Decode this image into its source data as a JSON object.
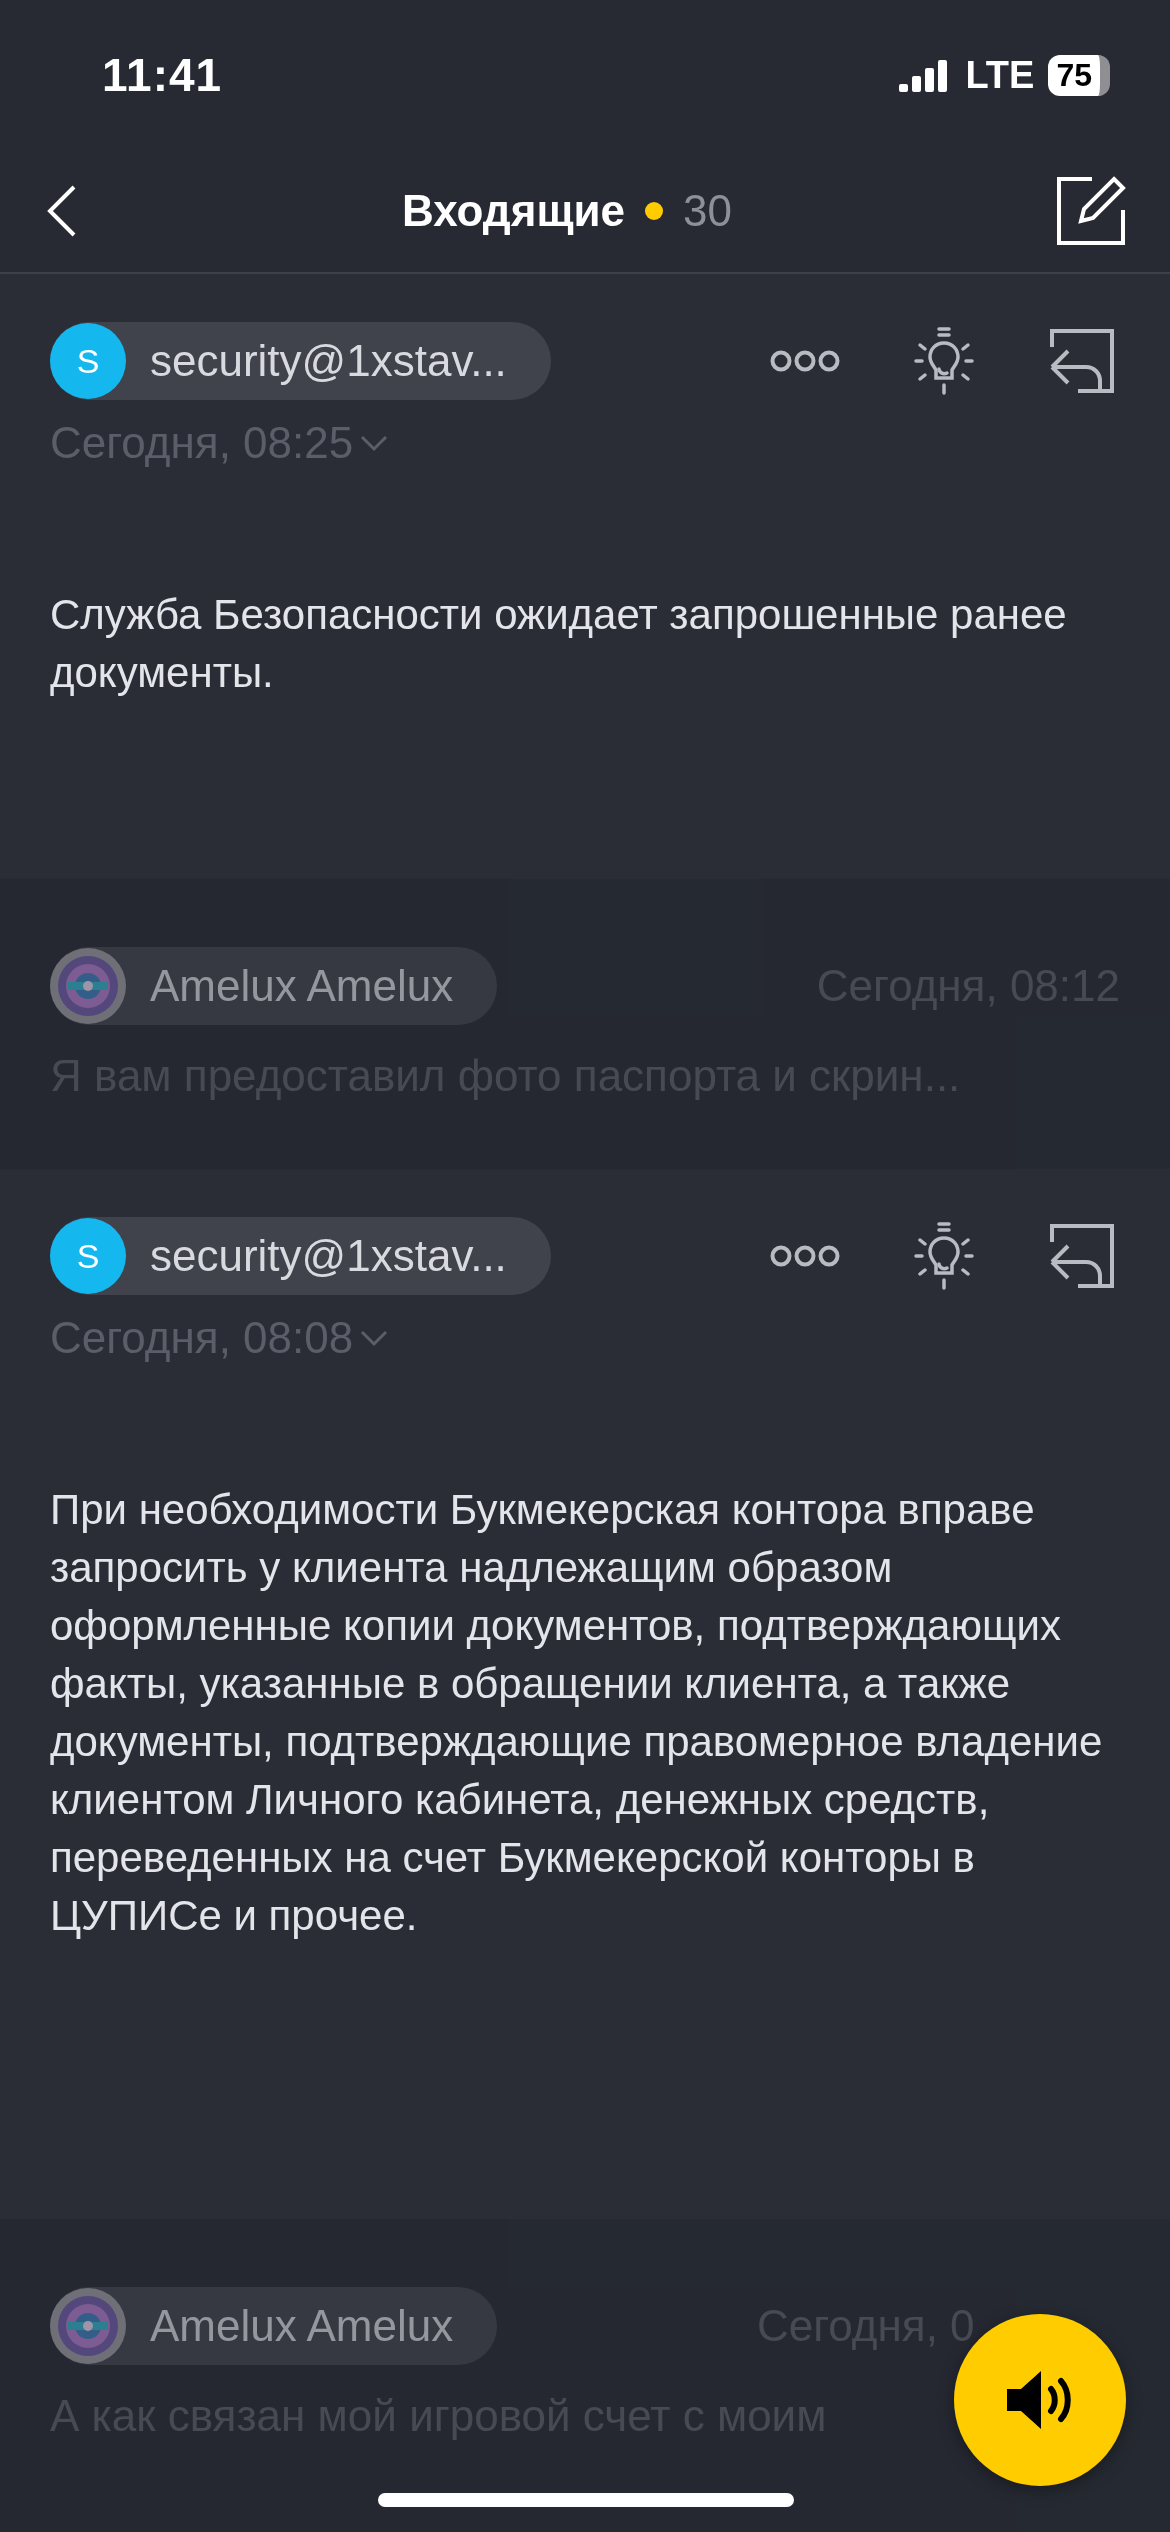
{
  "status_bar": {
    "time": "11:41",
    "network": "LTE",
    "battery": "75"
  },
  "nav": {
    "title": "Входящие",
    "unread_count": "30"
  },
  "messages": [
    {
      "kind": "expanded",
      "sender": "security@1xstav...",
      "avatar_letter": "S",
      "date": "Сегодня, 08:25",
      "body": "Служба Безопасности ожидает запрошенные ранее документы."
    },
    {
      "kind": "collapsed",
      "sender": "Amelux Amelux",
      "date": "Сегодня, 08:12",
      "preview": "Я вам предоставил фото паспорта и скрин..."
    },
    {
      "kind": "expanded",
      "sender": "security@1xstav...",
      "avatar_letter": "S",
      "date": "Сегодня, 08:08",
      "body": "При необходимости Букмекерская контора вправе запросить у клиента надлежащим образом оформленные копии документов, подтверждающих факты, указанные в обращении клиента, а также документы, подтверждающие правомерное владение клиентом Личного кабинета, денежных средств, переведенных на счет Букмекерской конторы в ЦУПИСе и прочее."
    },
    {
      "kind": "collapsed",
      "sender": "Amelux Amelux",
      "date": "Сегодня, 0",
      "preview": "А как связан мой игровой счет с моим"
    }
  ]
}
